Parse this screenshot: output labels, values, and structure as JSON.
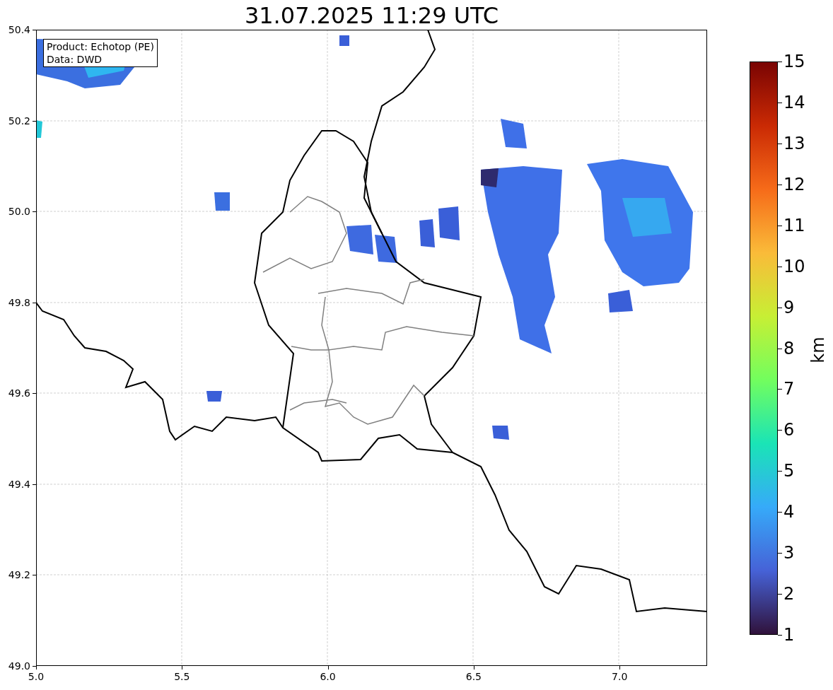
{
  "title": "31.07.2025 11:29 UTC",
  "annotation": [
    "Product: Echotop (PE)",
    "Data: DWD"
  ],
  "x_axis": {
    "ticks": [
      "5.0",
      "5.5",
      "6.0",
      "6.5",
      "7.0"
    ]
  },
  "y_axis": {
    "ticks": [
      "50.4",
      "50.2",
      "50.0",
      "49.8",
      "49.6",
      "49.4",
      "49.2",
      "49.0"
    ]
  },
  "colorbar": {
    "label": "km",
    "ticks": [
      "15",
      "14",
      "13",
      "12",
      "11",
      "10",
      "9",
      "8",
      "7",
      "6",
      "5",
      "4",
      "3",
      "2",
      "1"
    ]
  }
}
